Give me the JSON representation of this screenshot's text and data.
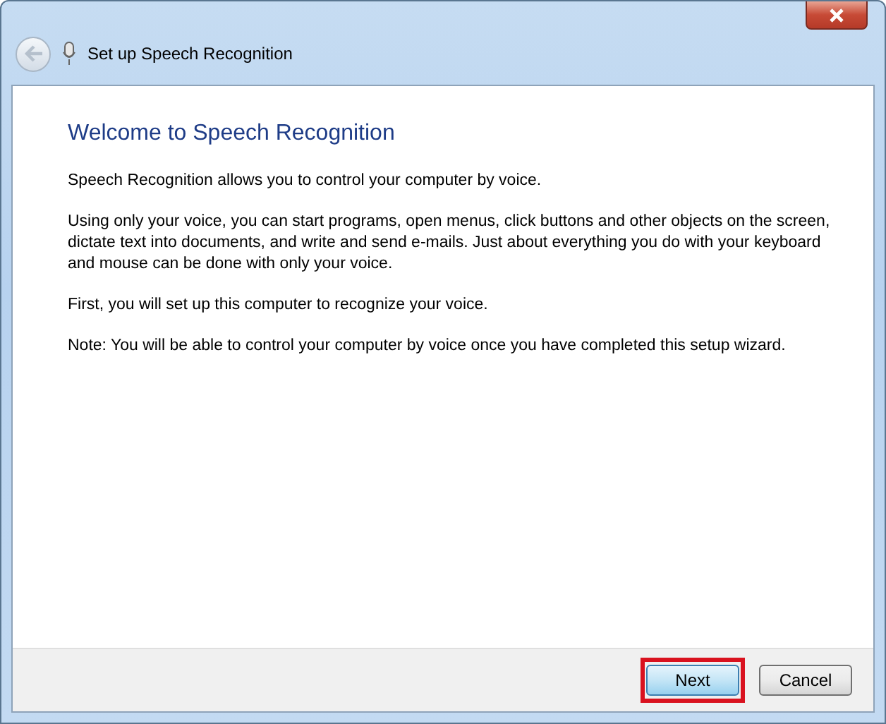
{
  "window": {
    "title": "Set up Speech Recognition",
    "back_disabled": true
  },
  "heading": "Welcome to Speech Recognition",
  "paragraphs": [
    "Speech Recognition allows you to control your computer by voice.",
    "Using only your voice, you can start programs, open menus, click buttons and other objects on the screen, dictate text into documents, and write and send e-mails. Just about everything you do with your keyboard and mouse can be done with only your voice.",
    "First, you will set up this computer to recognize your voice.",
    "Note: You will be able to control your computer by voice once you have completed this setup wizard."
  ],
  "buttons": [
    {
      "label": "Next",
      "default": true,
      "highlighted": true
    },
    {
      "label": "Cancel",
      "default": false,
      "highlighted": false
    }
  ]
}
